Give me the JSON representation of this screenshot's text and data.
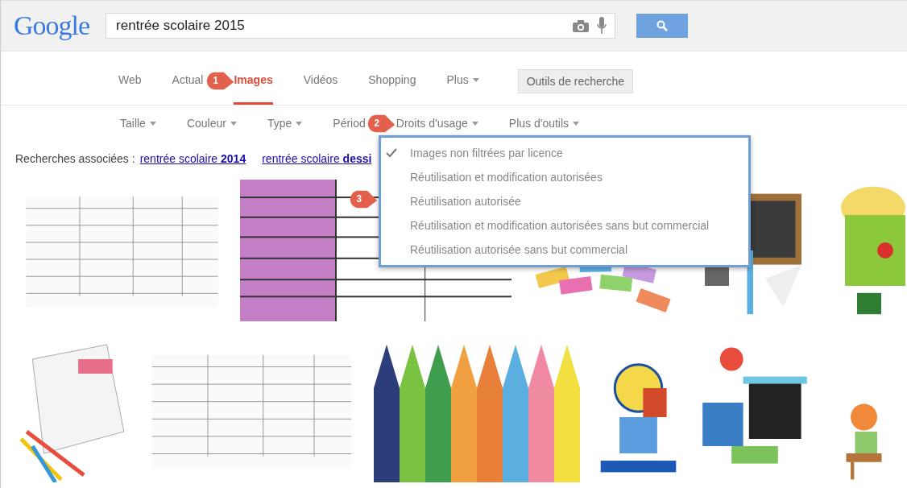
{
  "header": {
    "logo": "Google",
    "query": "rentrée scolaire 2015"
  },
  "tabs": [
    {
      "label": "Web",
      "selected": false,
      "caret": false
    },
    {
      "label": "Actual",
      "selected": false,
      "caret": false
    },
    {
      "label": "Images",
      "selected": true,
      "caret": false
    },
    {
      "label": "Vidéos",
      "selected": false,
      "caret": false
    },
    {
      "label": "Shopping",
      "selected": false,
      "caret": false
    },
    {
      "label": "Plus",
      "selected": false,
      "caret": true
    }
  ],
  "tools_button": "Outils de recherche",
  "filters": [
    {
      "label": "Taille",
      "caret": true
    },
    {
      "label": "Couleur",
      "caret": true
    },
    {
      "label": "Type",
      "caret": true
    },
    {
      "label": "Périod",
      "caret": false
    },
    {
      "label": "Droits d'usage",
      "caret": true
    },
    {
      "label": "Plus d'outils",
      "caret": true
    }
  ],
  "related": {
    "label": "Recherches associées :",
    "links": [
      "rentrée scolaire **2014**",
      "rentrée scolaire **dessi**"
    ]
  },
  "menu": {
    "items": [
      {
        "label": "Images non filtrées par licence",
        "checked": true
      },
      {
        "label": "Réutilisation et modification autorisées",
        "checked": false
      },
      {
        "label": "Réutilisation autorisée",
        "checked": false
      },
      {
        "label": "Réutilisation et modification autorisées sans but commercial",
        "checked": false
      },
      {
        "label": "Réutilisation autorisée sans but commercial",
        "checked": false
      }
    ]
  },
  "callouts": [
    "1",
    "2",
    "3"
  ]
}
